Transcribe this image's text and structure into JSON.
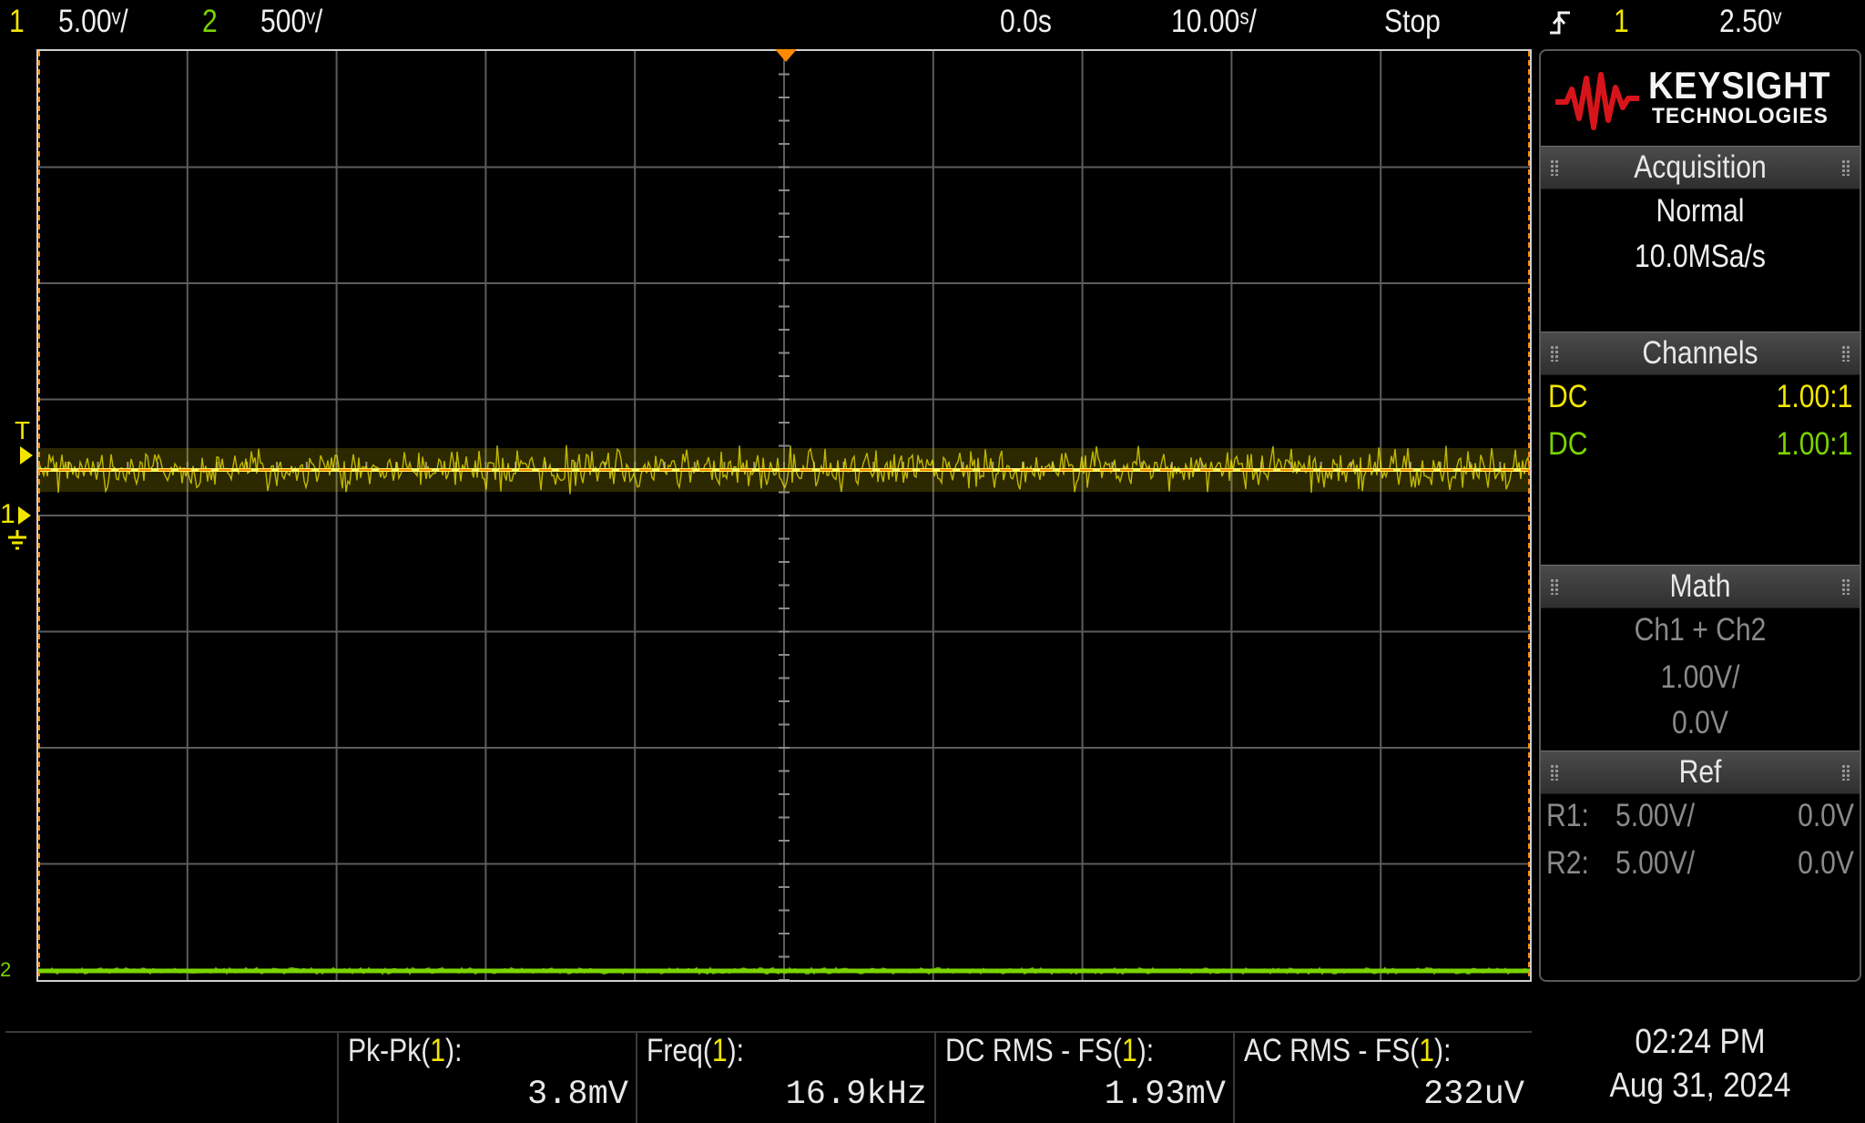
{
  "topbar": {
    "ch1_num": "1",
    "ch1_scale": "5.00ᵛ/",
    "ch2_num": "2",
    "ch2_scale": "500ᵛ/",
    "time_delay": "0.0s",
    "time_scale": "10.00ˢ/",
    "run_state": "Stop",
    "trigger_icon": "rising-edge-trigger-icon",
    "trigger_source": "1",
    "trigger_level": "2.50ᵛ"
  },
  "brand": {
    "name": "KEYSIGHT",
    "sub": "TECHNOLOGIES",
    "logo_color": "#d8141b"
  },
  "acquisition": {
    "title": "Acquisition",
    "mode": "Normal",
    "rate": "10.0MSa/s"
  },
  "channels": {
    "title": "Channels",
    "rows": [
      {
        "coupling": "DC",
        "probe": "1.00:1",
        "color": "#f2e600"
      },
      {
        "coupling": "DC",
        "probe": "1.00:1",
        "color": "#7bd400"
      }
    ]
  },
  "math": {
    "title": "Math",
    "func": "Ch1 + Ch2",
    "scale": "1.00V/",
    "offset": "0.0V"
  },
  "ref": {
    "title": "Ref",
    "rows": [
      {
        "label": "R1:",
        "scale": "5.00V/",
        "offset": "0.0V"
      },
      {
        "label": "R2:",
        "scale": "5.00V/",
        "offset": "0.0V"
      }
    ]
  },
  "markers": {
    "trigger_marker": "T",
    "ch1_marker": "1",
    "ch2_marker": "2"
  },
  "measurements": [
    {
      "label_pre": "Pk-Pk(",
      "ch": "1",
      "label_post": "):",
      "value": "3.8mV"
    },
    {
      "label_pre": "Freq(",
      "ch": "1",
      "label_post": "):",
      "value": "16.9kHz"
    },
    {
      "label_pre": "DC RMS - FS(",
      "ch": "1",
      "label_post": "):",
      "value": "1.93mV"
    },
    {
      "label_pre": "AC RMS - FS(",
      "ch": "1",
      "label_post": "):",
      "value": "232uV"
    }
  ],
  "clock": {
    "time": "02:24 PM",
    "date": "Aug 31, 2024"
  },
  "colors": {
    "ch1": "#f2e600",
    "ch2": "#7bd400",
    "marker_orange": "#ff8a00",
    "grid": "#5c5c5c"
  }
}
